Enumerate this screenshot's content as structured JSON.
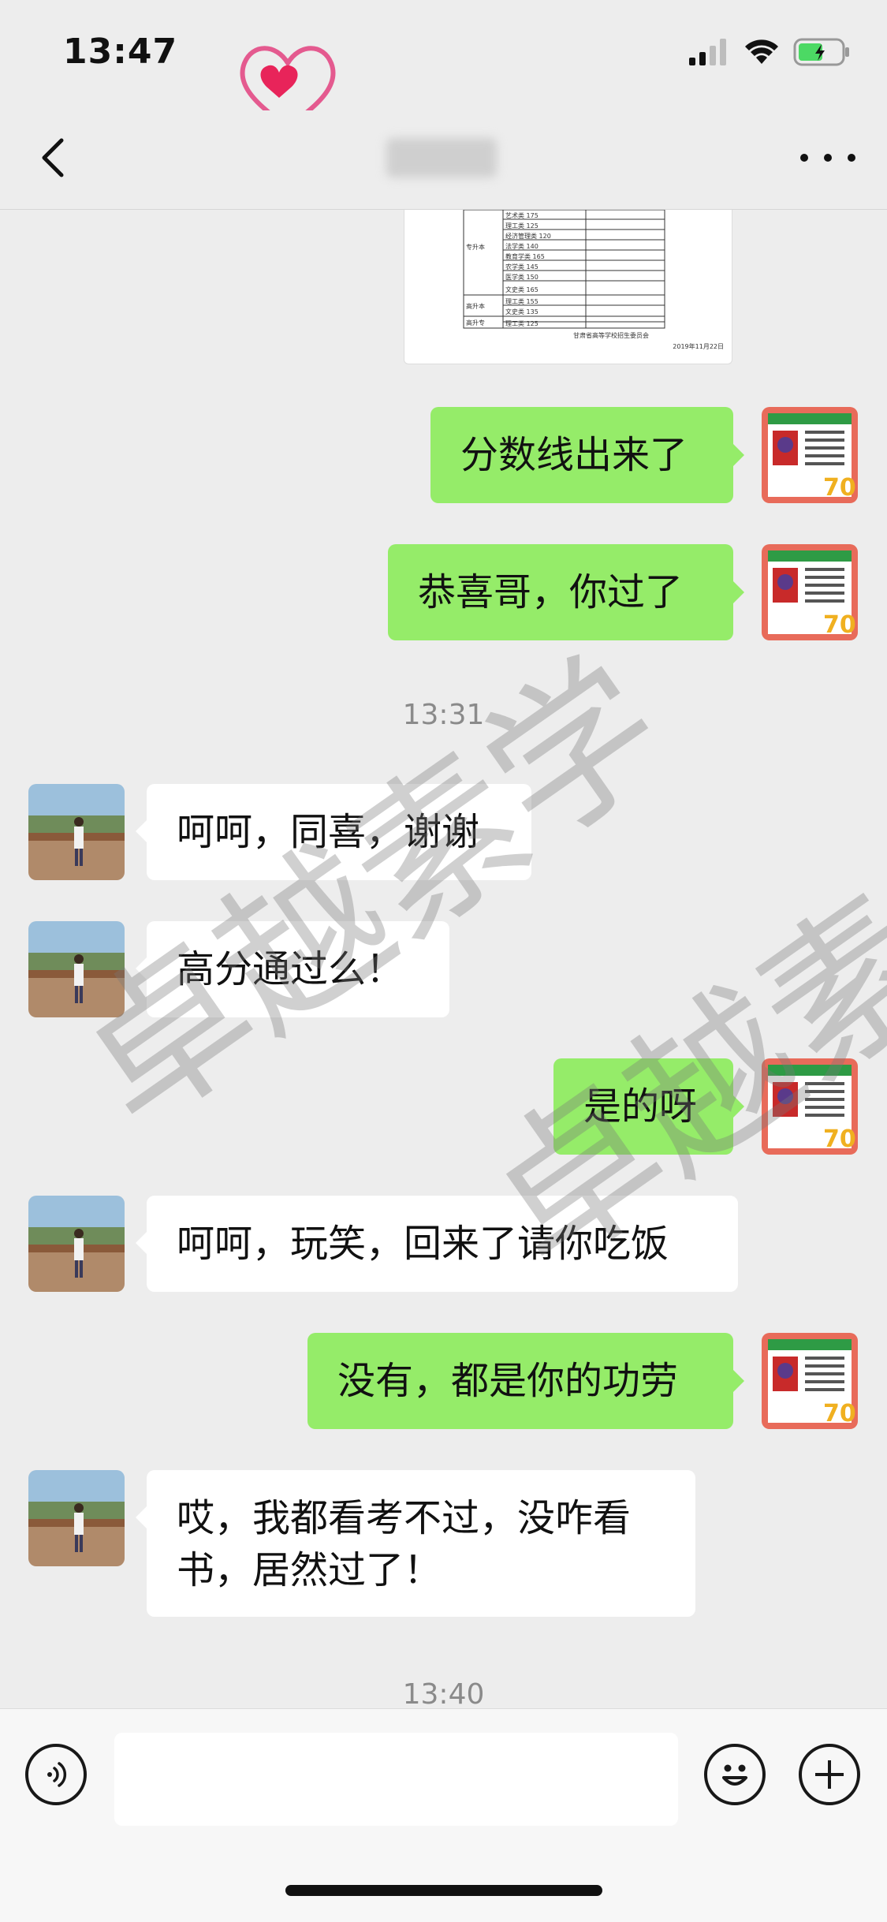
{
  "status_bar": {
    "time": "13:47"
  },
  "header": {
    "title_blurred": ""
  },
  "messages": {
    "m1": "分数线出来了",
    "m2": "恭喜哥，你过了",
    "ts1": "13:31",
    "m3": "呵呵，同喜，谢谢",
    "m4": "高分通过么！",
    "m5": "是的呀",
    "m6": "呵呵，玩笑，回来了请你吃饭",
    "m7": "没有，都是你的功劳",
    "m8": "哎，我都看考不过，没咋看书，居然过了！",
    "ts2": "13:40"
  },
  "document_preview": {
    "rows": [
      "艺术类 175",
      "理工类 125",
      "经济管理类 120",
      "法学类 140",
      "教育学类 165",
      "农学类 145",
      "医学类 150",
      "文史类 165",
      "理工类 155",
      "文史类 135",
      "理工类 125"
    ],
    "footer1": "甘肃省高等学校招生委员会",
    "footer2": "2019年11月22日"
  },
  "watermark_text": "卓越素学",
  "colors": {
    "my_bubble": "#95ec69",
    "their_bubble": "#ffffff",
    "background": "#ededed"
  },
  "icons": [
    "back-chevron-icon",
    "more-dots-icon",
    "voice-icon",
    "emoji-icon",
    "plus-icon",
    "signal-icon",
    "wifi-icon",
    "battery-icon"
  ]
}
